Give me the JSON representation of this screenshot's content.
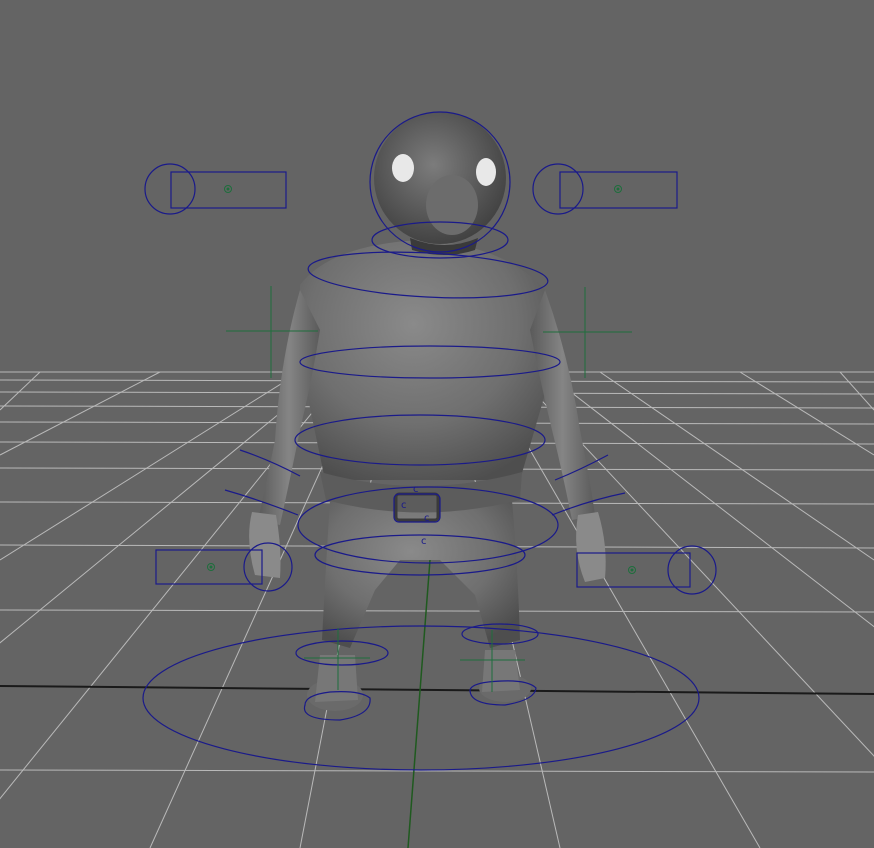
{
  "viewport": {
    "background": "#646464",
    "grid_color": "#c8c8c8",
    "axis_color": "#1a1a1a",
    "y_axis_color": "#1f5a1f",
    "control_color": "#1a1a8a",
    "locator_color": "#1e6e3c",
    "mesh_color": "#7a7a7a"
  },
  "controls": {
    "cog_labels": [
      "c",
      "c",
      "c",
      "c"
    ]
  }
}
